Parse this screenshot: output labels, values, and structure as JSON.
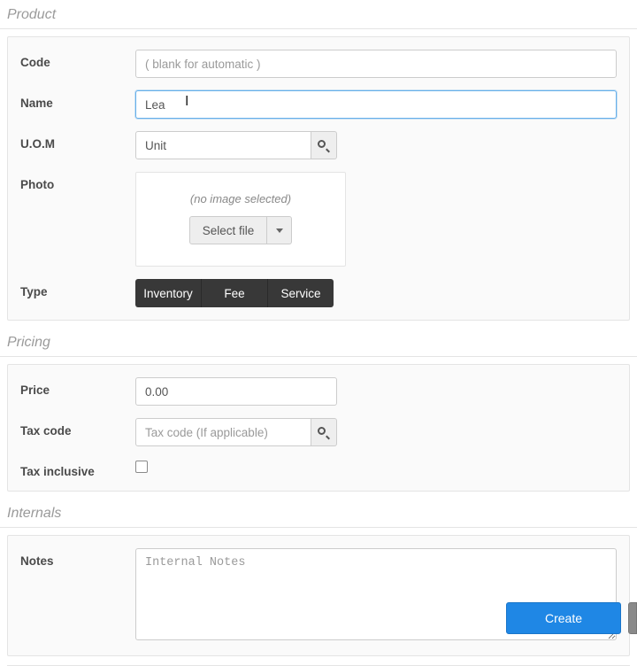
{
  "sections": {
    "product": "Product",
    "pricing": "Pricing",
    "internals": "Internals"
  },
  "product": {
    "code_label": "Code",
    "code_placeholder": "( blank for automatic )",
    "name_label": "Name",
    "name_value": "Lea",
    "uom_label": "U.O.M",
    "uom_value": "Unit",
    "photo_label": "Photo",
    "photo_caption": "(no image selected)",
    "select_file": "Select file",
    "type_label": "Type",
    "type_options": [
      "Inventory",
      "Fee",
      "Service"
    ]
  },
  "pricing": {
    "price_label": "Price",
    "price_value": "0.00",
    "tax_code_label": "Tax code",
    "tax_code_placeholder": "Tax code (If applicable)",
    "tax_inclusive_label": "Tax inclusive",
    "tax_inclusive_checked": false
  },
  "internals": {
    "notes_label": "Notes",
    "notes_placeholder": "Internal Notes"
  },
  "footer": {
    "create": "Create"
  }
}
